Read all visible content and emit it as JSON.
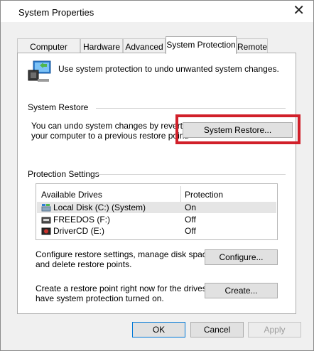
{
  "window": {
    "title": "System Properties"
  },
  "tabs": [
    {
      "label": "Computer Name"
    },
    {
      "label": "Hardware"
    },
    {
      "label": "Advanced"
    },
    {
      "label": "System Protection"
    },
    {
      "label": "Remote"
    }
  ],
  "intro": "Use system protection to undo unwanted system changes.",
  "restore_group": {
    "title": "System Restore",
    "desc_line1": "You can undo system changes by reverting",
    "desc_line2": "your computer to a previous restore point.",
    "button": "System Restore..."
  },
  "protection_group": {
    "title": "Protection Settings",
    "columns": [
      "Available Drives",
      "Protection"
    ],
    "drives": [
      {
        "name": "Local Disk (C:) (System)",
        "protection": "On"
      },
      {
        "name": "FREEDOS (F:)",
        "protection": "Off"
      },
      {
        "name": "DriverCD (E:)",
        "protection": "Off"
      }
    ],
    "configure_line1": "Configure restore settings, manage disk space,",
    "configure_line2": "and delete restore points.",
    "configure_button": "Configure...",
    "create_line1": "Create a restore point right now for the drives that",
    "create_line2": "have system protection turned on.",
    "create_button": "Create..."
  },
  "footer": {
    "ok": "OK",
    "cancel": "Cancel",
    "apply": "Apply"
  },
  "colors": {
    "highlight": "#d1202a",
    "focus": "#0078d7"
  }
}
